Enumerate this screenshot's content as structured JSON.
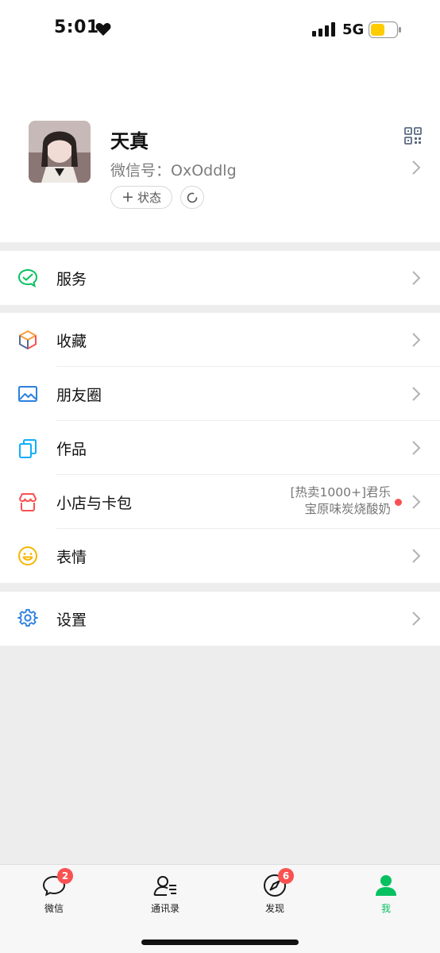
{
  "status_bar": {
    "time": "5:01",
    "network": "5G"
  },
  "profile": {
    "name": "天真",
    "wechat_id_label": "微信号：",
    "wechat_id": "OxOddlg",
    "status_button": "状态"
  },
  "menu": {
    "services": "服务",
    "favorites": "收藏",
    "moments": "朋友圈",
    "works": "作品",
    "shop": "小店与卡包",
    "shop_promo_line1": "[热卖1000+]君乐",
    "shop_promo_line2": "宝原味炭烧酸奶",
    "stickers": "表情",
    "settings": "设置"
  },
  "tabs": [
    {
      "label": "微信",
      "badge": "2"
    },
    {
      "label": "通讯录",
      "badge": ""
    },
    {
      "label": "发现",
      "badge": "6"
    },
    {
      "label": "我",
      "badge": ""
    }
  ],
  "colors": {
    "accent": "#07c160",
    "badge": "#fa5151",
    "background": "#ededed"
  }
}
